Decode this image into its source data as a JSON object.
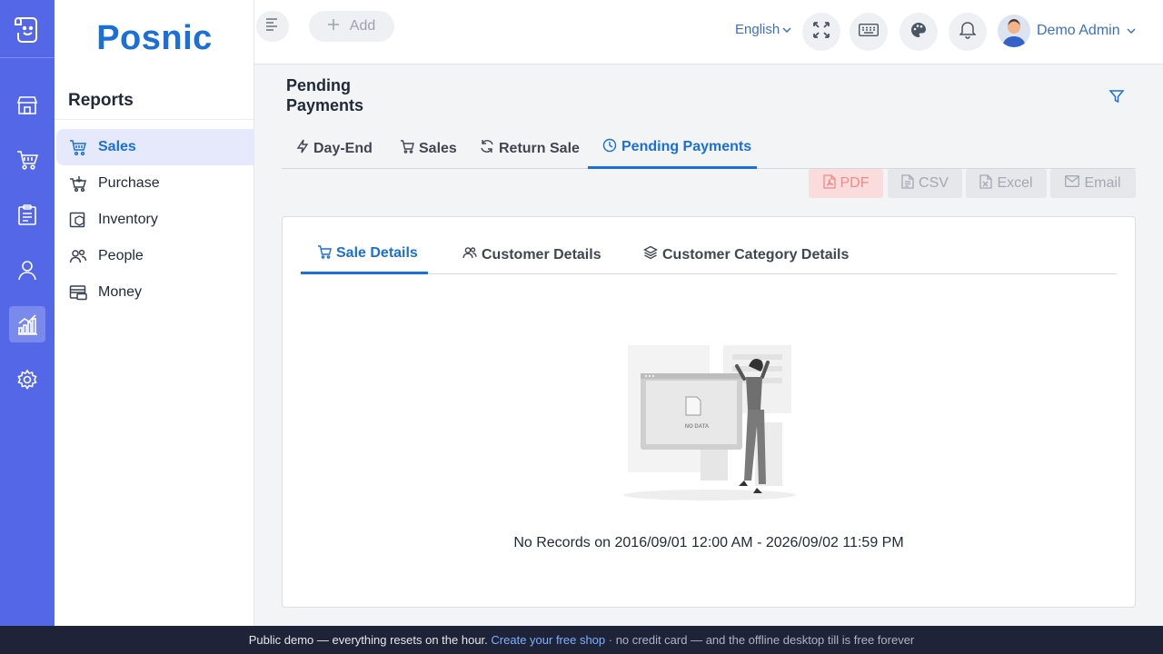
{
  "brand": {
    "name": "Posnic"
  },
  "sidebar": {
    "heading": "Reports",
    "items": [
      {
        "label": "Sales",
        "icon": "cart-icon",
        "active": true
      },
      {
        "label": "Purchase",
        "icon": "basket-icon"
      },
      {
        "label": "Inventory",
        "icon": "box-icon"
      },
      {
        "label": "People",
        "icon": "people-icon"
      },
      {
        "label": "Money",
        "icon": "money-icon"
      }
    ]
  },
  "header": {
    "add_label": "Add",
    "language": "English",
    "user_name": "Demo Admin"
  },
  "page": {
    "title": "Pending Payments",
    "tabs": [
      {
        "label": "Day-End",
        "icon": "bolt-icon"
      },
      {
        "label": "Sales",
        "icon": "cart-icon"
      },
      {
        "label": "Return Sale",
        "icon": "refresh-icon"
      },
      {
        "label": "Pending Payments",
        "icon": "clock-icon",
        "active": true
      }
    ],
    "export_buttons": [
      {
        "label": "PDF",
        "icon": "pdf-icon"
      },
      {
        "label": "CSV",
        "icon": "csv-icon"
      },
      {
        "label": "Excel",
        "icon": "excel-icon"
      },
      {
        "label": "Email",
        "icon": "mail-icon"
      }
    ]
  },
  "card": {
    "tabs": [
      {
        "label": "Sale Details",
        "icon": "cart-icon",
        "active": true
      },
      {
        "label": "Customer Details",
        "icon": "users-icon"
      },
      {
        "label": "Customer Category Details",
        "icon": "layers-icon"
      }
    ],
    "illustration_text": "NO DATA",
    "empty_message": "No Records on 2016/09/01 12:00 AM - 2026/09/02 11:59 PM"
  },
  "footer": {
    "text_before": "Public demo — everything resets on the hour.",
    "link_text": "Create your free shop",
    "text_after": "· no credit card — and the offline desktop till is free forever"
  },
  "colors": {
    "rail": "#5468e7",
    "accent": "#1a6fd8",
    "footer": "#1e2337"
  }
}
